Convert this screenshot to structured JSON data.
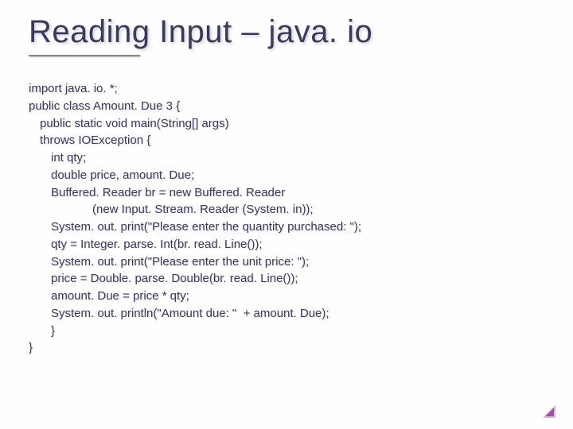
{
  "slide": {
    "title": "Reading Input – java. io",
    "code": {
      "l0": "import java. io. *;",
      "l1": "public class Amount. Due 3 {",
      "l2": "public static void main(String[] args)",
      "l3": "throws IOException {",
      "l4": "int qty;",
      "l5": "double price, amount. Due;",
      "l6": "Buffered. Reader br = new Buffered. Reader",
      "l7": "(new Input. Stream. Reader (System. in));",
      "l8": "System. out. print(\"Please enter the quantity purchased: \");",
      "l9": "qty = Integer. parse. Int(br. read. Line());",
      "l10": "System. out. print(\"Please enter the unit price: \");",
      "l11": "price = Double. parse. Double(br. read. Line());",
      "l12": "amount. Due = price * qty;",
      "l13": "System. out. println(\"Amount due: \"  + amount. Due);",
      "l14": "}",
      "l15": "}"
    }
  }
}
